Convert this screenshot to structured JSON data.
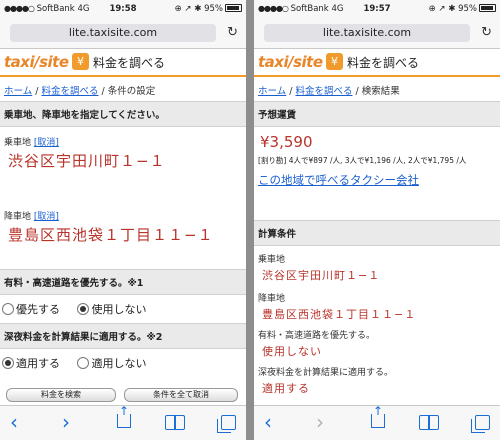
{
  "left": {
    "status": {
      "carrier": "SoftBank",
      "network": "4G",
      "time": "19:58",
      "battery": "95%",
      "icons": "⊕ ↗ ✱"
    },
    "url": "lite.taxisite.com",
    "brand": {
      "logo": "taxi/site",
      "title": "料金を調べる"
    },
    "breadcrumb": {
      "home": "ホーム",
      "search": "料金を調べる",
      "current": "条件の設定",
      "sep": " / "
    },
    "section_points": "乗車地、降車地を指定してください。",
    "pickup": {
      "label": "乗車地",
      "cancel": "[取消]",
      "address": "渋谷区宇田川町１−１"
    },
    "dropoff": {
      "label": "降車地",
      "cancel": "[取消]",
      "address": "豊島区西池袋１丁目１１−１"
    },
    "section_toll": "有料・高速道路を優先する。※1",
    "toll_options": [
      "優先する",
      "使用しない"
    ],
    "section_night": "深夜料金を計算結果に適用する。※2",
    "night_options": [
      "適用する",
      "適用しない"
    ],
    "buttons": {
      "search": "料金を検索",
      "clear": "条件を全て取消"
    }
  },
  "right": {
    "status": {
      "carrier": "SoftBank",
      "network": "4G",
      "time": "19:57",
      "battery": "95%",
      "icons": "⊕ ↗ ✱"
    },
    "url": "lite.taxisite.com",
    "brand": {
      "logo": "taxi/site",
      "title": "料金を調べる"
    },
    "breadcrumb": {
      "home": "ホーム",
      "search": "料金を調べる",
      "current": "検索結果",
      "sep": " / "
    },
    "section_fare": "予想運賃",
    "fare": "¥3,590",
    "split": "[割り勘] 4人で¥897 /人, 3人で¥1,196 /人, 2人で¥1,795 /人",
    "taxi_link": "この地域で呼べるタクシー会社",
    "section_conditions": "計算条件",
    "pickup": {
      "label": "乗車地",
      "value": "渋谷区宇田川町１−１"
    },
    "dropoff": {
      "label": "降車地",
      "value": "豊島区西池袋１丁目１１−１"
    },
    "toll": {
      "label": "有料・高速道路を優先する。",
      "value": "使用しない"
    },
    "night": {
      "label": "深夜料金を計算結果に適用する。",
      "value": "適用する"
    }
  },
  "toolbar_icons": [
    "back-icon",
    "forward-icon",
    "share-icon",
    "bookmarks-icon",
    "tabs-icon"
  ],
  "colors": {
    "accent": "#f29b2d",
    "link": "#1a5fd0",
    "address": "#b8332a",
    "toolbar": "#1a6ed8"
  }
}
